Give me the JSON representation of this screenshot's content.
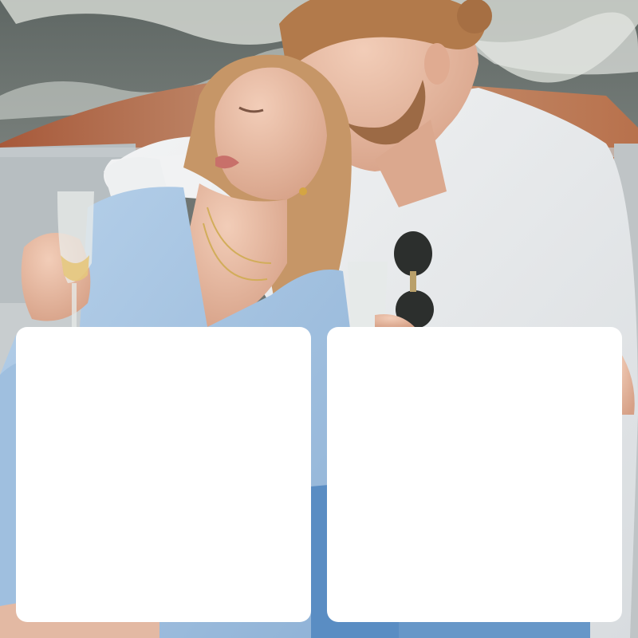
{
  "colors": {
    "card_background": "#ffffff",
    "water": "#6c7471",
    "foam": "#dfe2dc",
    "boat_deck": "#b9825e",
    "cushion": "#b9bfc2",
    "woman_dress": "#a9c6e3",
    "man_shirt": "#eceeef",
    "skin": "#e7b79e",
    "hair_woman": "#c99a68",
    "hair_man": "#b47c4d",
    "trousers": "#5b8fc4"
  },
  "photo": {
    "description_icon": "couple-photo-image"
  },
  "cards": [
    {
      "id": "left"
    },
    {
      "id": "right"
    }
  ]
}
